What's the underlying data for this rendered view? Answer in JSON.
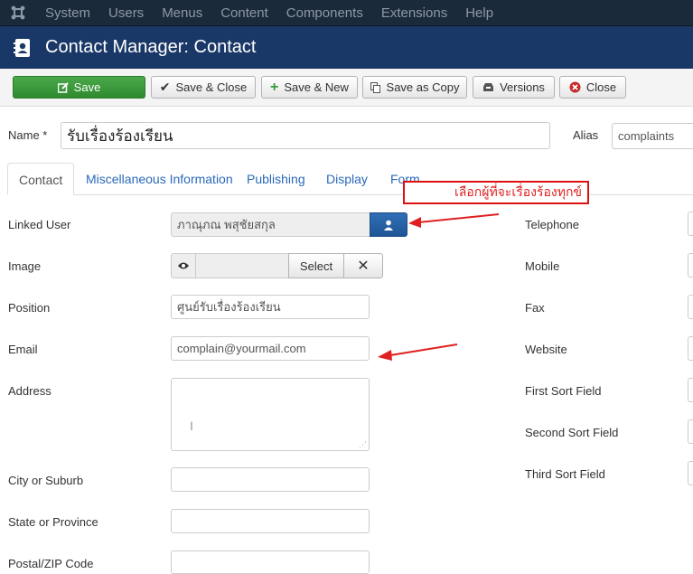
{
  "topnav": {
    "items": [
      "System",
      "Users",
      "Menus",
      "Content",
      "Components",
      "Extensions",
      "Help"
    ]
  },
  "header": {
    "title": "Contact Manager: Contact"
  },
  "toolbar": {
    "save": "Save",
    "save_close": "Save & Close",
    "save_new": "Save & New",
    "save_copy": "Save as Copy",
    "versions": "Versions",
    "close": "Close"
  },
  "form": {
    "name_label": "Name *",
    "name_value": "รับเรื่องร้องเรียน",
    "alias_label": "Alias",
    "alias_value": "complaints"
  },
  "tabs": [
    "Contact",
    "Miscellaneous Information",
    "Publishing",
    "Display",
    "Form"
  ],
  "annotation": {
    "callout_text": "เลือกผู้ที่จะเรื่องร้องทุกข์"
  },
  "contact": {
    "linked_user_label": "Linked User",
    "linked_user_value": "ภาณุภณ พสุชัยสกุล",
    "image_label": "Image",
    "image_select": "Select",
    "position_label": "Position",
    "position_value": "ศูนย์รับเรื่องร้องเรียน",
    "email_label": "Email",
    "email_value": "complain@yourmail.com",
    "address_label": "Address",
    "city_label": "City or Suburb",
    "state_label": "State or Province",
    "postal_label": "Postal/ZIP Code"
  },
  "right_fields": {
    "telephone": "Telephone",
    "mobile": "Mobile",
    "fax": "Fax",
    "website": "Website",
    "first_sort": "First Sort Field",
    "second_sort": "Second Sort Field",
    "third_sort": "Third Sort Field"
  },
  "colors": {
    "nav_bg": "#1b2a3a",
    "title_bg": "#1a3867",
    "save_green": "#3a9a3a",
    "link_blue": "#2a69b8",
    "annotation_red": "#e02020"
  }
}
